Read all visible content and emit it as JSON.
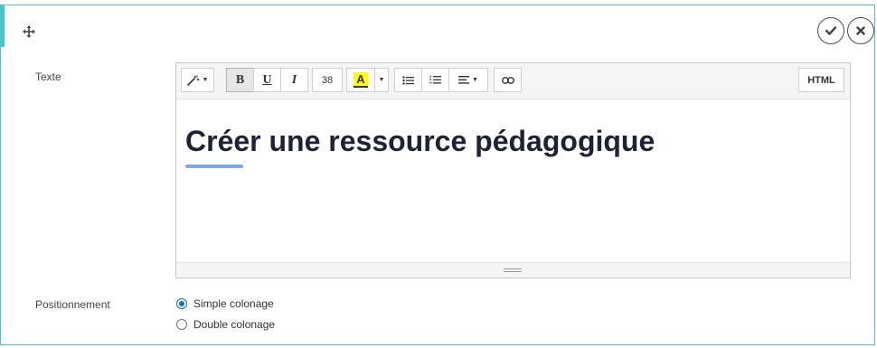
{
  "actions": {
    "move_icon": "move-arrows-icon",
    "validate_icon": "checkmark-icon",
    "close_icon": "close-x-icon"
  },
  "fields": {
    "text_label": "Texte",
    "position_label": "Positionnement"
  },
  "toolbar": {
    "style_icon": "magic-wand-icon",
    "bold": "B",
    "underline": "U",
    "italic": "I",
    "font_size": "38",
    "highlight": "A",
    "bullet_list_icon": "unordered-list-icon",
    "numbered_list_icon": "ordered-list-icon",
    "align_icon": "align-left-icon",
    "link_icon": "link-icon",
    "html_label": "HTML"
  },
  "editor": {
    "content": "Créer une ressource pédagogique"
  },
  "positioning": {
    "options": [
      {
        "label": "Simple colonage",
        "selected": true
      },
      {
        "label": "Double colonage",
        "selected": false
      }
    ]
  },
  "colors": {
    "accent": "#4fc3c8",
    "highlight": "#ffff00",
    "radio": "#0f6ed6",
    "heading_underline": "#7da6ec"
  }
}
